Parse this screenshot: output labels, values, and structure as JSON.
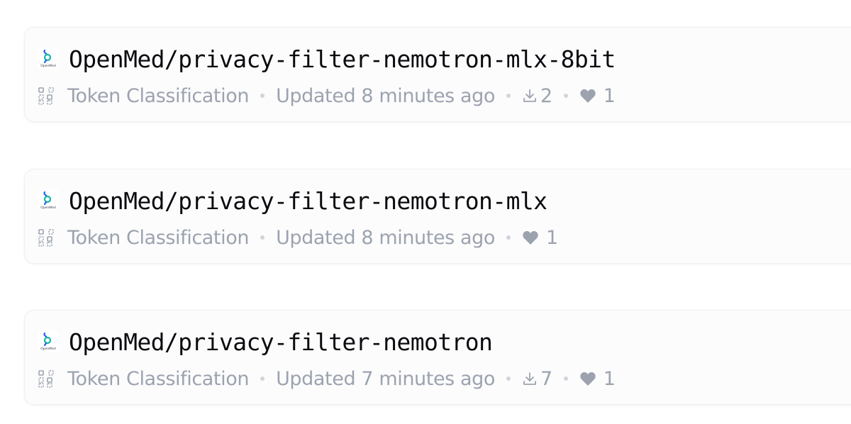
{
  "models": [
    {
      "name": "OpenMed/privacy-filter-nemotron-mlx-8bit",
      "task": "Token Classification",
      "updated": "Updated 8 minutes ago",
      "downloads": "2",
      "likes": "1"
    },
    {
      "name": "OpenMed/privacy-filter-nemotron-mlx",
      "task": "Token Classification",
      "updated": "Updated 8 minutes ago",
      "likes": "1"
    },
    {
      "name": "OpenMed/privacy-filter-nemotron",
      "task": "Token Classification",
      "updated": "Updated 7 minutes ago",
      "downloads": "7",
      "likes": "1"
    }
  ],
  "avatar_text": "OpenMed",
  "icons": {
    "avatar": "openmed-logo-icon",
    "task": "token-classification-icon",
    "downloads": "download-icon",
    "likes": "heart-icon"
  },
  "colors": {
    "title": "#0b0b0f",
    "meta": "#9ca3af",
    "card_bg": "#fcfcfd",
    "card_border": "#eef0f3",
    "logo_blue": "#2563eb",
    "logo_teal": "#14b8a6"
  }
}
